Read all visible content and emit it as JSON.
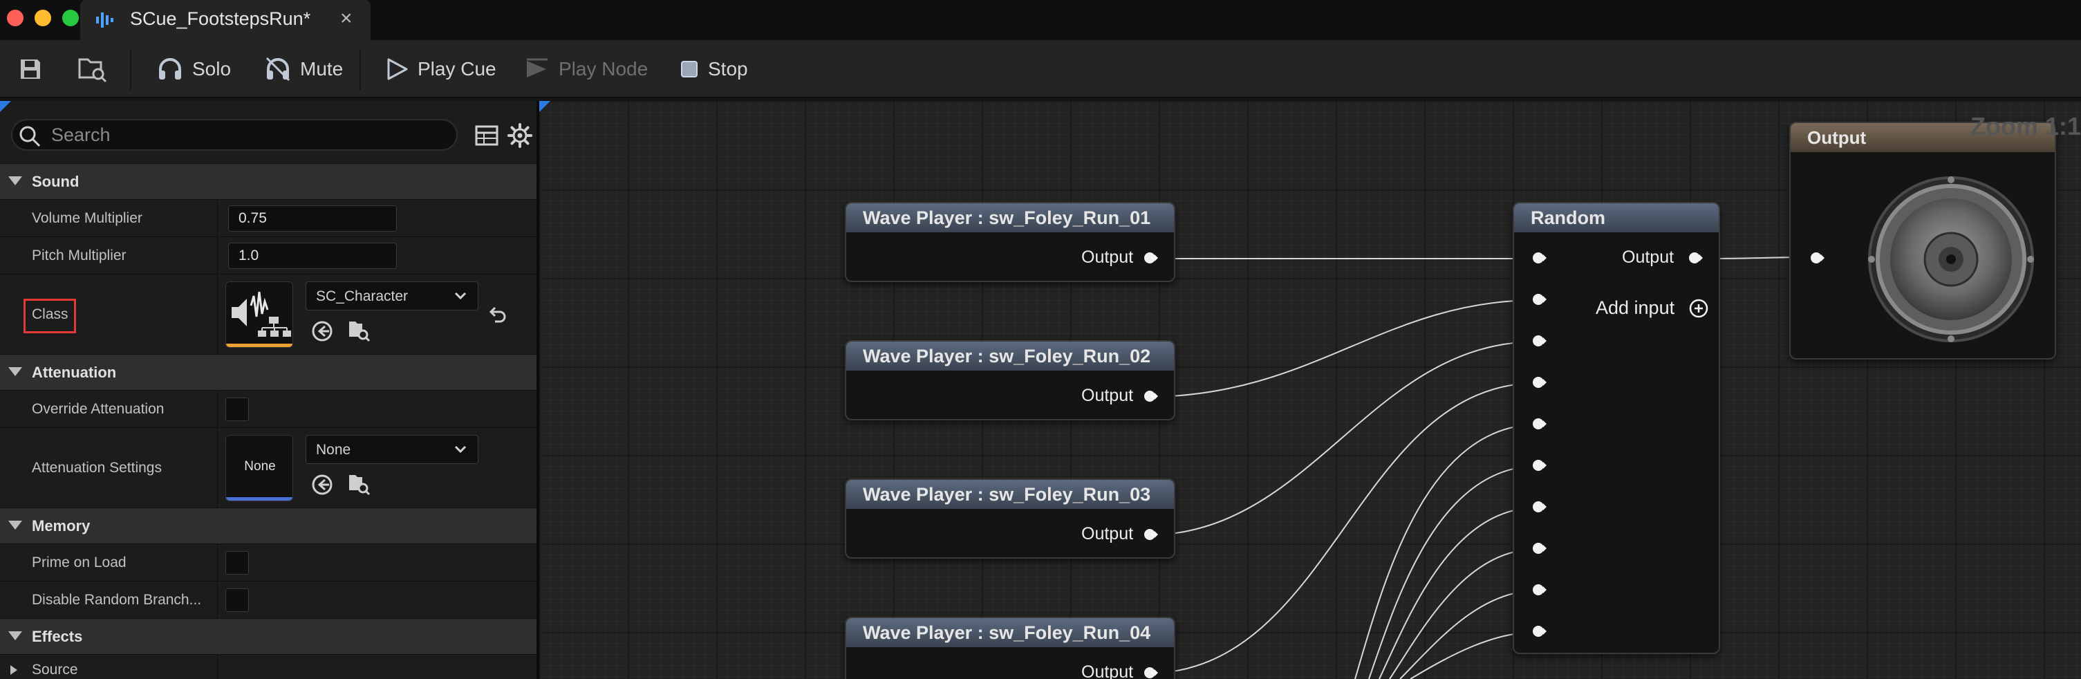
{
  "window": {
    "tab_title": "SCue_FootstepsRun*",
    "close_glyph": "×",
    "traffic_colors": [
      "#ff5f57",
      "#febc2e",
      "#28c840"
    ]
  },
  "toolbar": {
    "save_icon": "save-icon",
    "browse_icon": "browse-folder-icon",
    "solo": "Solo",
    "mute": "Mute",
    "play_cue": "Play Cue",
    "play_node": "Play Node",
    "stop": "Stop"
  },
  "details": {
    "search_placeholder": "Search",
    "sections": {
      "sound": "Sound",
      "attenuation": "Attenuation",
      "memory": "Memory",
      "effects": "Effects"
    },
    "rows": {
      "volume_multiplier": {
        "label": "Volume Multiplier",
        "value": "0.75"
      },
      "pitch_multiplier": {
        "label": "Pitch Multiplier",
        "value": "1.0"
      },
      "class": {
        "label": "Class",
        "value": "SC_Character"
      },
      "override_attenuation": {
        "label": "Override Attenuation",
        "checked": false
      },
      "attenuation_settings": {
        "label": "Attenuation Settings",
        "thumb_text": "None",
        "value": "None"
      },
      "prime_on_load": {
        "label": "Prime on Load",
        "checked": false
      },
      "disable_random_branch": {
        "label": "Disable Random Branch...",
        "checked": false
      },
      "source": {
        "label": "Source"
      }
    },
    "accent": {
      "class_bar": "#f0a030",
      "attenuation_bar": "#4a6fd6",
      "highlight": "#e53935"
    }
  },
  "graph": {
    "zoom_label": "Zoom 1:1",
    "wave_players": [
      {
        "title": "Wave Player : sw_Foley_Run_01",
        "output": "Output"
      },
      {
        "title": "Wave Player : sw_Foley_Run_02",
        "output": "Output"
      },
      {
        "title": "Wave Player : sw_Foley_Run_03",
        "output": "Output"
      },
      {
        "title": "Wave Player : sw_Foley_Run_04",
        "output": "Output"
      }
    ],
    "random": {
      "title": "Random",
      "output": "Output",
      "add_input": "Add input"
    },
    "output_node": {
      "title": "Output"
    }
  }
}
